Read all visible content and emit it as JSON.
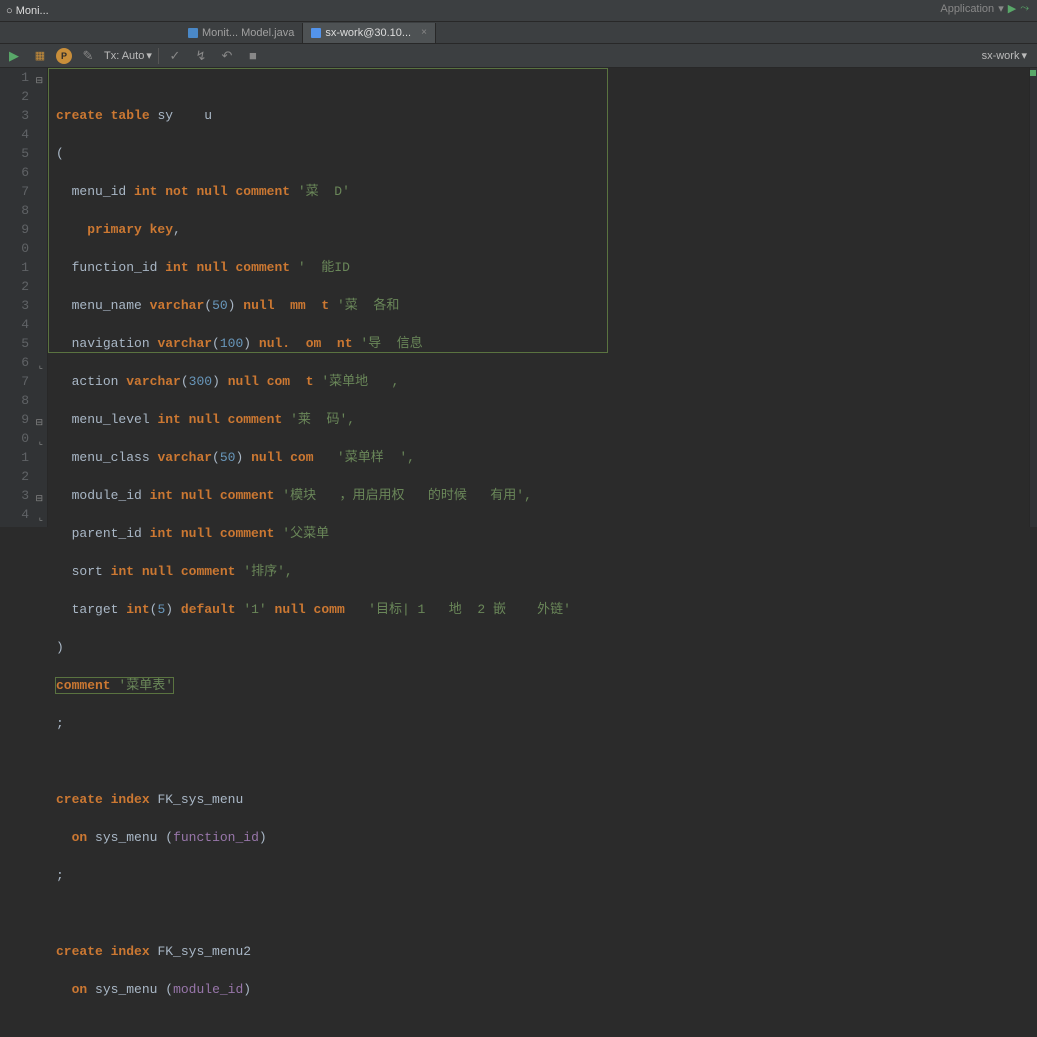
{
  "app_name": "Moni...",
  "tabs": [
    {
      "label": "Monit... Model.java"
    },
    {
      "label": "sx-work@30.10..."
    }
  ],
  "toolbar": {
    "tx_label": "Tx: Auto",
    "run_config": "Application",
    "workspace": "sx-work"
  },
  "gutter_lines": [
    "1",
    "2",
    "3",
    "4",
    "5",
    "6",
    "7",
    "8",
    "9",
    "0",
    "1",
    "2",
    "3",
    "4",
    "5",
    "6",
    "7",
    "8",
    "9",
    "0",
    "1",
    "2",
    "3",
    "4"
  ],
  "sql": {
    "l1": {
      "create_table": "create table",
      "name": "sy    u"
    },
    "l2": "(",
    "l3": {
      "col": "menu_id",
      "type": "int not null comment",
      "str": "'菜  D'"
    },
    "l4": {
      "pk": "primary key",
      "comma": ","
    },
    "l5": {
      "col": "function_id",
      "type": "int null comment",
      "str": "'  能ID"
    },
    "l6": {
      "col": "menu_name",
      "type1": "varchar",
      "num": "50",
      "type2": "null",
      "cmt": "mm  t",
      "str": "'菜  各和"
    },
    "l7": {
      "col": "navigation",
      "type1": "varchar",
      "num": "100",
      "type2": "nul.  om  nt",
      "str": "'导  信息"
    },
    "l8": {
      "col": "action",
      "type1": "varchar",
      "num": "300",
      "type2": "null com  t",
      "str": "'菜单地   ,"
    },
    "l9": {
      "col": "menu_level",
      "type": "int null comment",
      "str": "'莱  码',"
    },
    "l10": {
      "col": "menu_class",
      "type1": "varchar",
      "num": "50",
      "type2": "null com",
      "str": "'菜单样  ',"
    },
    "l11": {
      "col": "module_id",
      "type": "int null comment",
      "str": "'模块   ，用启用权   的时候   有用',"
    },
    "l12": {
      "col": "parent_id",
      "type": "int null comment",
      "str": "'父菜单"
    },
    "l13": {
      "col": "sort",
      "type": "int null comment",
      "str": "'排序',"
    },
    "l14": {
      "col": "target",
      "type1": "int",
      "num": "5",
      "dflt": "default",
      "dstr": "'1'",
      "type2": "null comm",
      "str": "'目标| 1   地  2 嵌    外链'"
    },
    "l15": ")",
    "l16": {
      "kw": "comment",
      "str": "'菜单表'"
    },
    "l17": ";",
    "l19": {
      "kw": "create index",
      "name": "FK_sys_menu"
    },
    "l20": {
      "kw": "on",
      "tbl": "sys_menu",
      "col": "function_id"
    },
    "l21": ";",
    "l23": {
      "kw": "create index",
      "name": "FK_sys_menu2"
    },
    "l24": {
      "kw": "on",
      "tbl": "sys_menu",
      "col": "module_id"
    }
  }
}
